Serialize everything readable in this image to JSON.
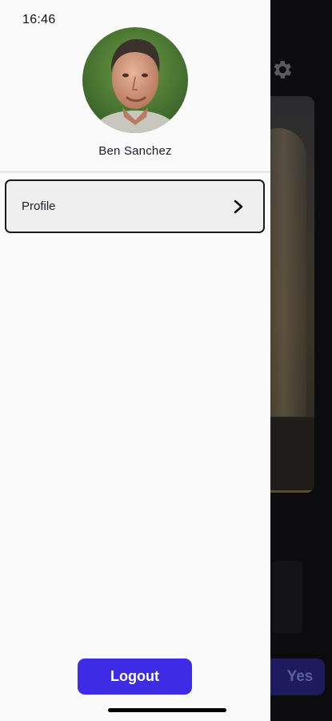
{
  "status_bar": {
    "time": "16:46"
  },
  "drawer": {
    "user": {
      "name": "Ben Sanchez"
    },
    "menu": [
      {
        "label": "Profile",
        "icon": "chevron-right-icon"
      }
    ],
    "logout_label": "Logout"
  },
  "background": {
    "settings_icon": "gear-icon",
    "yes_label": "Yes"
  },
  "colors": {
    "accent": "#3e2be6",
    "drawer_bg": "#fafafa",
    "overlay": "#0c0c0f"
  }
}
